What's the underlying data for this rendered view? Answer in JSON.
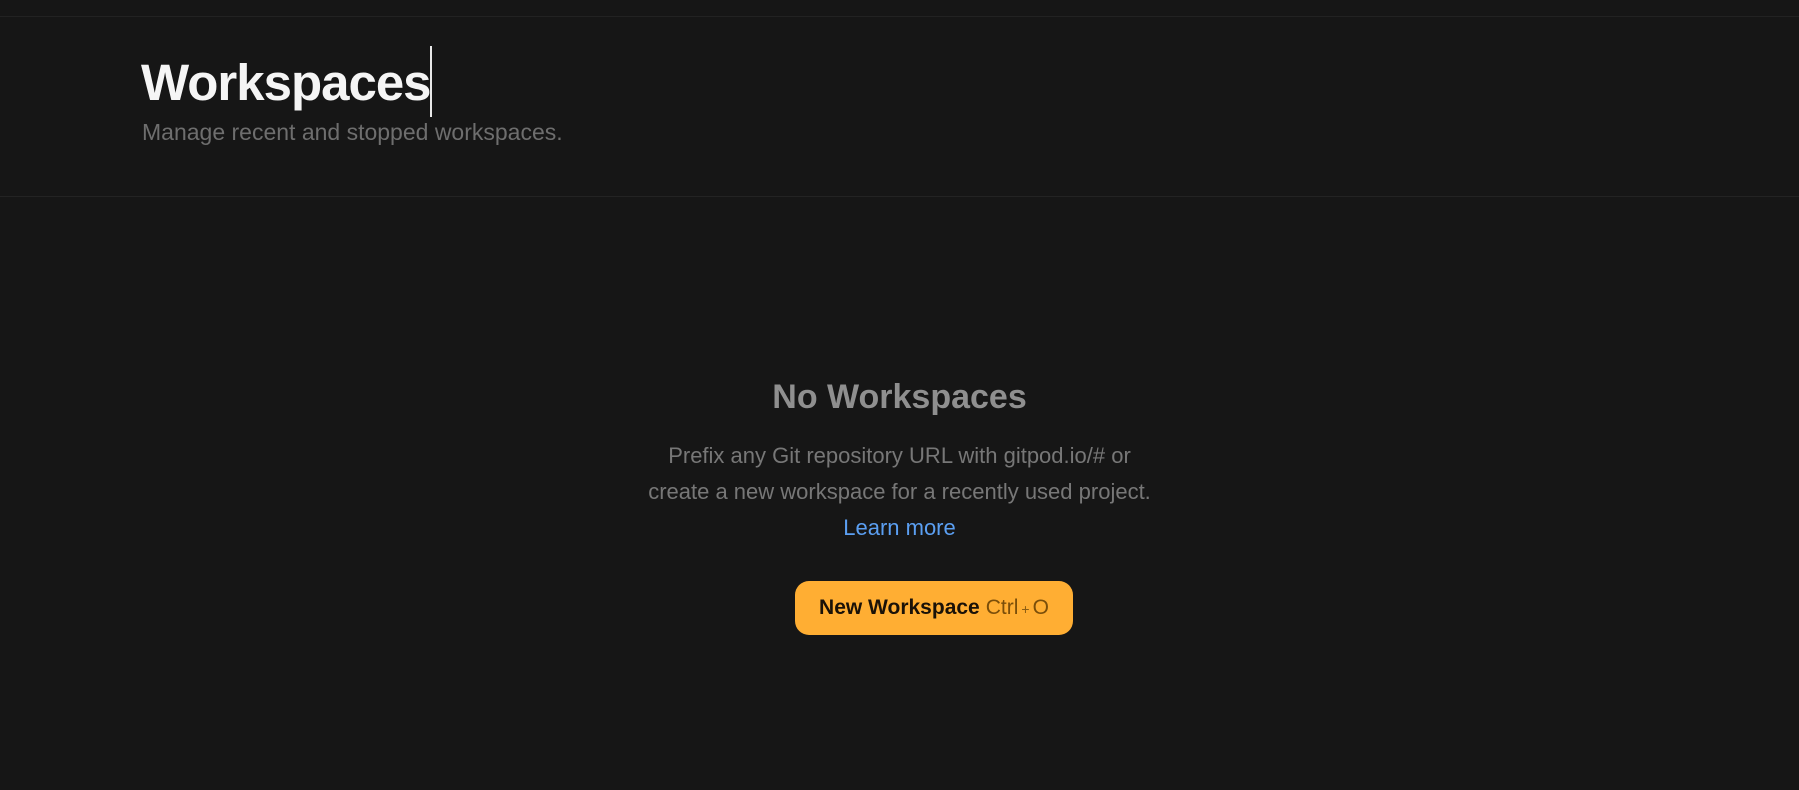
{
  "header": {
    "title": "Workspaces",
    "subtitle": "Manage recent and stopped workspaces."
  },
  "empty_state": {
    "title": "No Workspaces",
    "description_line1": "Prefix any Git repository URL with gitpod.io/# or",
    "description_line2": "create a new workspace for a recently used project.",
    "link_label": "Learn more"
  },
  "primary_action": {
    "label": "New Workspace",
    "shortcut_key1": "Ctrl",
    "shortcut_sep": "+",
    "shortcut_key2": "O"
  },
  "colors": {
    "background": "#161616",
    "accent_button": "#ffae33",
    "link": "#5b9ff2"
  }
}
